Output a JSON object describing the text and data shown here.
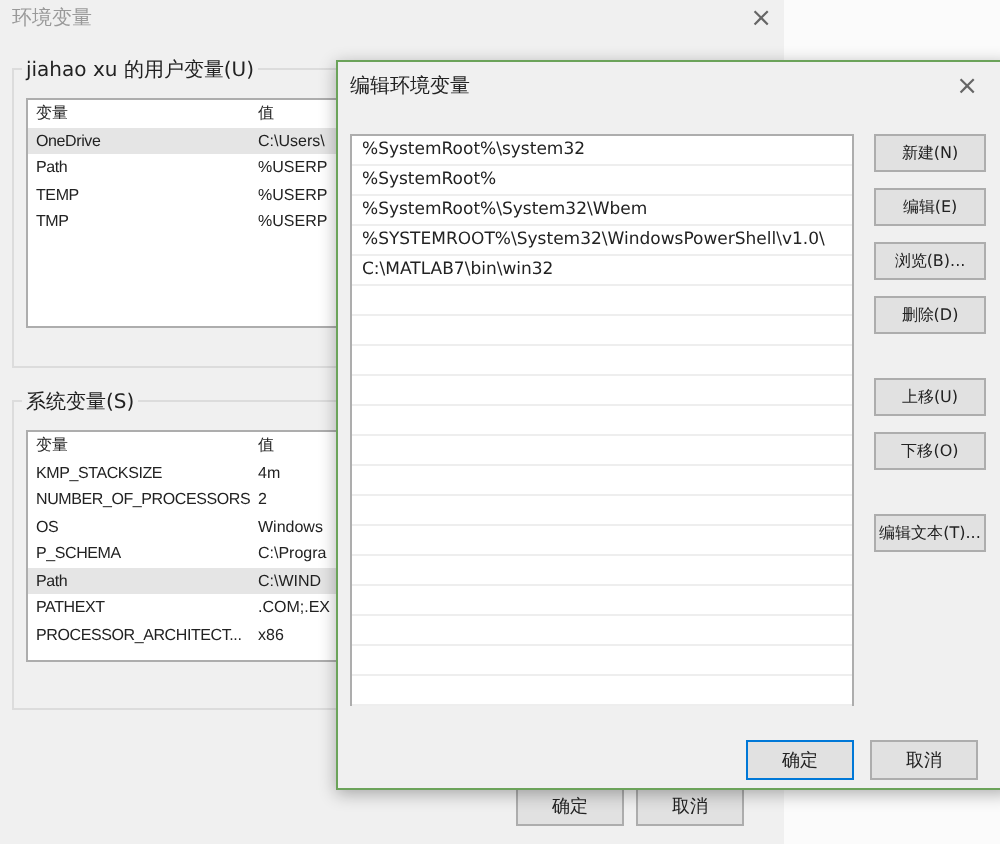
{
  "back_window": {
    "title": "环境变量",
    "close": "×",
    "user_group": {
      "label": "jiahao xu 的用户变量(U)",
      "columns": [
        "变量",
        "值"
      ],
      "rows": [
        {
          "name": "OneDrive",
          "value": "C:\\Users\\",
          "selected": true
        },
        {
          "name": "Path",
          "value": "%USERP",
          "selected": false
        },
        {
          "name": "TEMP",
          "value": "%USERP",
          "selected": false
        },
        {
          "name": "TMP",
          "value": "%USERP",
          "selected": false
        }
      ]
    },
    "system_group": {
      "label": "系统变量(S)",
      "columns": [
        "变量",
        "值"
      ],
      "rows": [
        {
          "name": "KMP_STACKSIZE",
          "value": "4m",
          "selected": false
        },
        {
          "name": "NUMBER_OF_PROCESSORS",
          "value": "2",
          "selected": false
        },
        {
          "name": "OS",
          "value": "Windows",
          "selected": false
        },
        {
          "name": "P_SCHEMA",
          "value": "C:\\Progra",
          "selected": false
        },
        {
          "name": "Path",
          "value": "C:\\WIND",
          "selected": true
        },
        {
          "name": "PATHEXT",
          "value": ".COM;.EX",
          "selected": false
        },
        {
          "name": "PROCESSOR_ARCHITECT...",
          "value": "x86",
          "selected": false
        }
      ]
    },
    "buttons": [
      "确定",
      "取消"
    ]
  },
  "edit_dialog": {
    "title": "编辑环境变量",
    "close": "×",
    "entries": [
      {
        "text": "%SystemRoot%\\system32"
      },
      {
        "text": "%SystemRoot%"
      },
      {
        "text": "%SystemRoot%\\System32\\Wbem"
      },
      {
        "text": "%SYSTEMROOT%\\System32\\WindowsPowerShell\\v1.0\\"
      },
      {
        "text": "C:\\MATLAB7\\bin\\win32"
      }
    ],
    "side_button_groups": [
      [
        "新建(N)",
        "编辑(E)",
        "浏览(B)...",
        "删除(D)"
      ],
      [
        "上移(U)",
        "下移(O)"
      ],
      [
        "编辑文本(T)..."
      ]
    ],
    "buttons": [
      {
        "label": "确定",
        "focused": true
      },
      {
        "label": "取消",
        "focused": false
      }
    ]
  }
}
